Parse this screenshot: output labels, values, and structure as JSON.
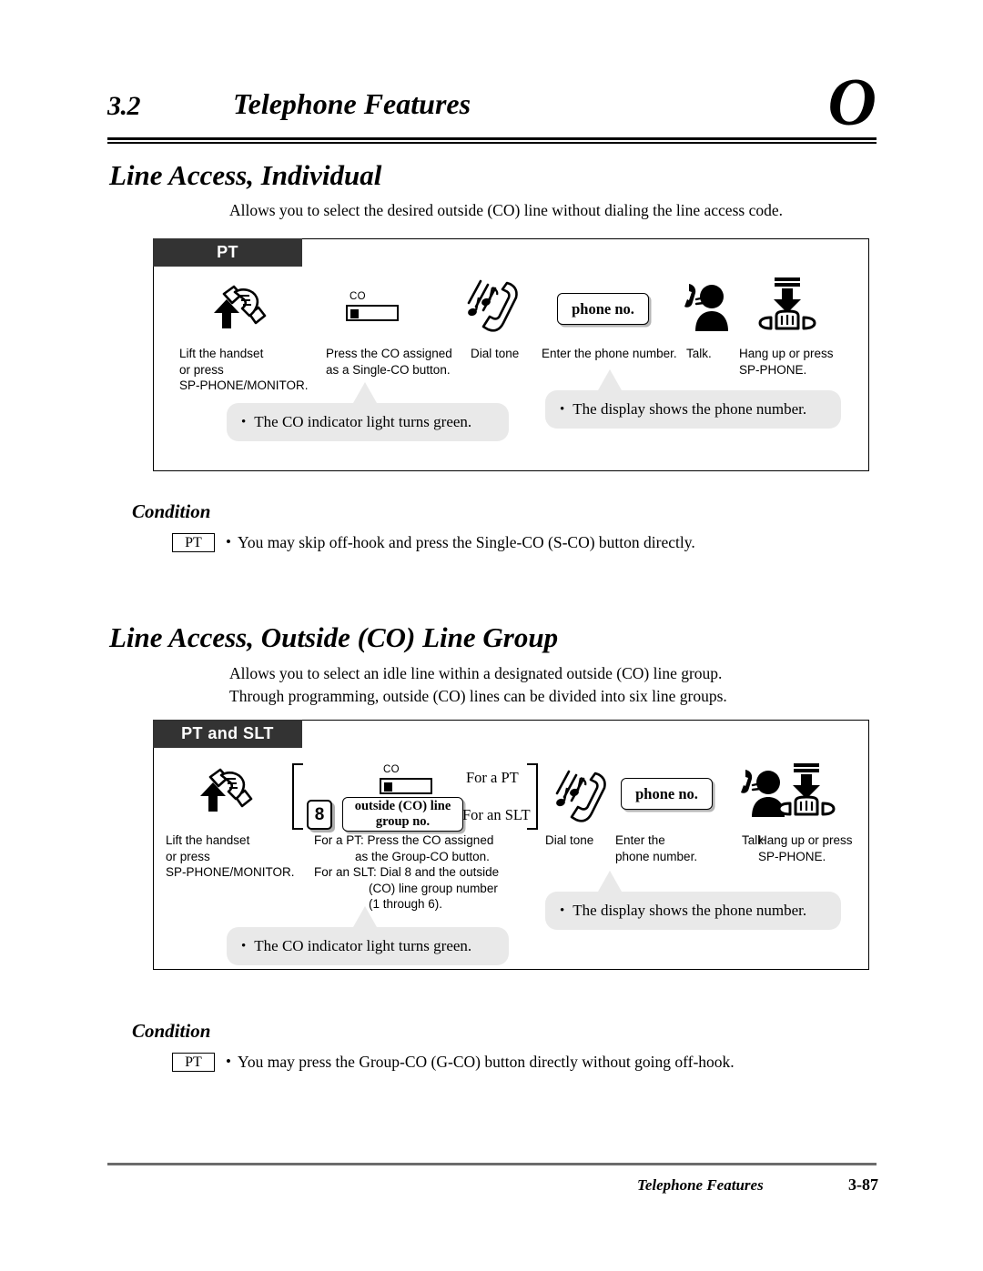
{
  "header": {
    "section_number": "3.2",
    "section_title": "Telephone Features",
    "corner_letter": "O"
  },
  "features": [
    {
      "title": "Line Access, Individual",
      "description_lines": [
        "Allows you to select the desired outside (CO) line without dialing the line access code."
      ],
      "diagram": {
        "tab_label": "PT",
        "steps": [
          {
            "icon": "lift-handset-icon",
            "caption_lines": [
              "Lift the handset",
              "or press",
              "SP-PHONE/MONITOR."
            ]
          },
          {
            "icon": "co-button-icon",
            "icon_label": "CO",
            "caption_lines": [
              "Press the CO assigned",
              "as a Single-CO button."
            ]
          },
          {
            "icon": "dial-tone-icon",
            "caption_lines": [
              "Dial tone"
            ]
          },
          {
            "icon": "phone-number-display-icon",
            "display_text": "phone no.",
            "caption_lines": [
              "Enter the phone number."
            ]
          },
          {
            "icon": "talk-icon",
            "caption_lines": [
              "Talk."
            ]
          },
          {
            "icon": "hang-up-icon",
            "caption_lines": [
              "Hang up or press",
              "SP-PHONE."
            ]
          }
        ],
        "callouts": [
          {
            "bullet": "•",
            "text": "The CO indicator light turns green."
          },
          {
            "bullet": "•",
            "text": "The display shows the phone number."
          }
        ]
      },
      "condition": {
        "heading": "Condition",
        "tag": "PT",
        "bullet": "•",
        "text": "You may skip off-hook and press the Single-CO (S-CO) button directly."
      }
    },
    {
      "title": "Line Access, Outside (CO) Line Group",
      "description_lines": [
        "Allows you to select an idle line within a designated outside (CO) line group.",
        "Through programming, outside (CO) lines can be divided into six line groups."
      ],
      "diagram": {
        "tab_label": "PT and SLT",
        "bracket_labels": {
          "top": "For a PT",
          "bottom": "For an SLT"
        },
        "keycap_digit": "8",
        "group_box_lines": [
          "outside (CO) line",
          "group no."
        ],
        "co_icon_label": "CO",
        "steps": [
          {
            "icon": "lift-handset-icon",
            "caption_lines": [
              "Lift the handset",
              "or press",
              "SP-PHONE/MONITOR."
            ]
          },
          {
            "icon": "group-co-selection",
            "caption_lines": [
              "For a PT: Press the CO assigned",
              "            as the Group-CO button.",
              "For an SLT: Dial 8 and the outside",
              "                (CO) line group number",
              "                (1 through 6)."
            ]
          },
          {
            "icon": "dial-tone-icon",
            "caption_lines": [
              "Dial tone"
            ]
          },
          {
            "icon": "phone-number-display-icon",
            "display_text": "phone no.",
            "caption_lines": [
              "Enter the",
              "phone number."
            ]
          },
          {
            "icon": "talk-icon",
            "caption_lines": [
              "Talk."
            ]
          },
          {
            "icon": "hang-up-icon",
            "caption_lines": [
              "Hang up or press",
              "SP-PHONE."
            ]
          }
        ],
        "callouts": [
          {
            "bullet": "•",
            "text": "The CO indicator light turns green."
          },
          {
            "bullet": "•",
            "text": "The display shows the phone number."
          }
        ]
      },
      "condition": {
        "heading": "Condition",
        "tag": "PT",
        "bullet": "•",
        "text": "You may press the Group-CO (G-CO) button directly without going off-hook."
      }
    }
  ],
  "footer": {
    "label": "Telephone Features",
    "page_number": "3-87"
  }
}
